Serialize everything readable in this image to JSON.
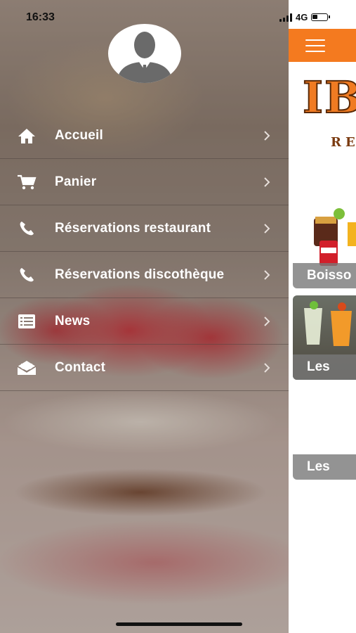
{
  "status_bar": {
    "time": "16:33",
    "network": "4G"
  },
  "drawer": {
    "menu": [
      {
        "label": "Accueil",
        "icon": "home-icon"
      },
      {
        "label": "Panier",
        "icon": "cart-icon"
      },
      {
        "label": "Réservations restaurant",
        "icon": "phone-icon"
      },
      {
        "label": "Réservations discothèque",
        "icon": "phone-icon"
      },
      {
        "label": "News",
        "icon": "list-icon"
      },
      {
        "label": "Contact",
        "icon": "envelope-icon"
      }
    ]
  },
  "main": {
    "accent_color": "#f47a1f",
    "logo_text": "IB",
    "logo_sub": "RE",
    "cards": [
      {
        "caption": "Boisso"
      },
      {
        "caption": "Les"
      },
      {
        "caption": "Les"
      }
    ]
  }
}
